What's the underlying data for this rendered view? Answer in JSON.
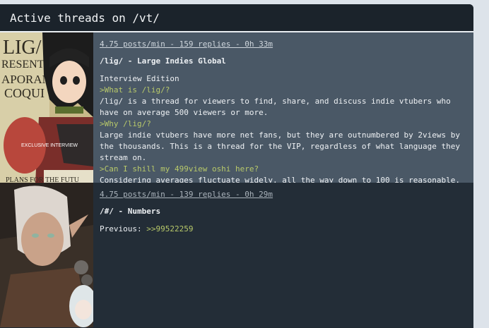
{
  "header": {
    "title": "Active threads on /vt/"
  },
  "threads": [
    {
      "meta": "4.75 posts/min - 159 replies - 0h 33m",
      "subject": "/lig/ - Large Indies Global",
      "lines": [
        {
          "text": "Interview Edition",
          "green": false
        },
        {
          "text": ">What is /lig/?",
          "green": true
        },
        {
          "text": "/lig/ is a thread for viewers to find, share, and discuss indie vtubers who have on average 500 viewers or more.",
          "green": false
        },
        {
          "text": ">Why /lig/?",
          "green": true
        },
        {
          "text": "Large indie vtubers have more net fans, but they are outnumbered by 2views by the thousands. This is a thread for the VIP, regardless of what language they stream on.",
          "green": false
        },
        {
          "text": ">Can I shill my 499view oshi here?",
          "green": true
        },
        {
          "text": "Considering averages fluctuate widely, all the way down to 100 is reasonable.",
          "green": false
        }
      ],
      "thumb": {
        "lettering": [
          "LIG/",
          "RESENTS",
          "APORANA",
          "COQUI",
          "EXCLUSIVE INTERVIEW",
          "PLANS FOR THE FUTU"
        ]
      }
    },
    {
      "meta": "4.75 posts/min - 139 replies - 0h 29m",
      "subject": "/#/ - Numbers",
      "previous_label": "Previous: ",
      "previous_link": ">>99522259"
    }
  ],
  "colors": {
    "greentext": "#b8c96a",
    "header_bg": "#1b232b",
    "thread1_bg": "#4a5866",
    "thread2_bg": "#232d37"
  }
}
